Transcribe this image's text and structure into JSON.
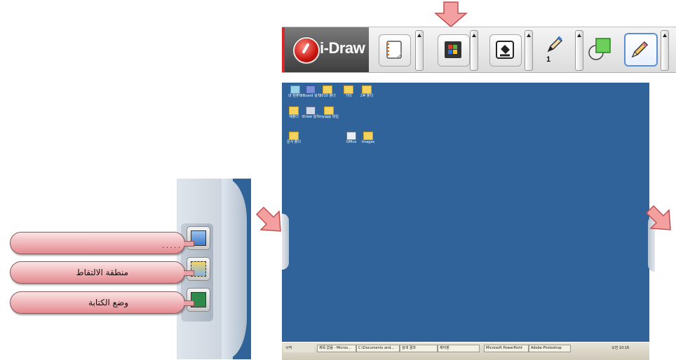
{
  "toolbar": {
    "brand_name": "i-Draw",
    "tools": [
      {
        "icon": "notepad-icon",
        "active": false
      },
      {
        "icon": "windows-desktop-icon",
        "active": false
      },
      {
        "icon": "paint-bucket-icon",
        "active": false
      },
      {
        "icon": "pen-icon",
        "active": false
      },
      {
        "icon": "shape-icon",
        "active": false
      },
      {
        "icon": "pencil-icon",
        "active": true
      }
    ],
    "pen_size": "1"
  },
  "side_panel": {
    "buttons": [
      {
        "icon": "screen-capture-icon"
      },
      {
        "icon": "area-capture-icon"
      },
      {
        "icon": "writing-mode-icon"
      }
    ]
  },
  "callouts": [
    {
      "label": ". . . . ."
    },
    {
      "label": "منطقة الالتقاط"
    },
    {
      "label": "وضع الكتابة"
    }
  ],
  "desktop": {
    "icons": [
      "내 컴퓨터",
      "i-Board 설치",
      "2010 폴더",
      "기타",
      "2# 폴더",
      "새폴더",
      "iDraw 설치",
      "myapp 파일",
      "문서 폴더",
      "Office",
      "Images"
    ],
    "taskbar_items": [
      "시작",
      "제목 없음 - Micros...",
      "C:\\Documents and...",
      "검색 결과",
      "제어판",
      "Microsoft PowerPoint",
      "Adobe Photoshop"
    ],
    "clock": "오전 10:16"
  },
  "colors": {
    "accent_red": "#d8262a",
    "desktop_blue": "#2f6399",
    "callout_pink": "#e48a8f",
    "arrow_pink": "#f08a8a"
  }
}
